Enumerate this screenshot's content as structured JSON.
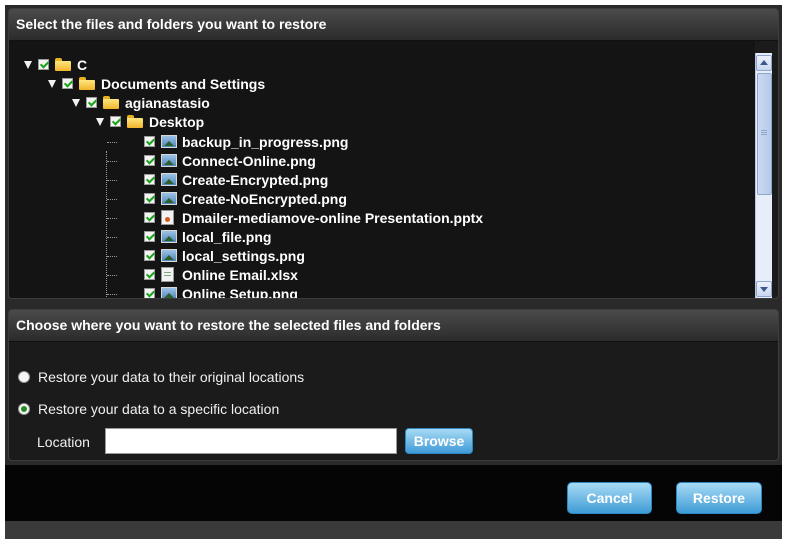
{
  "restore_panel": {
    "title": "Select the files and folders you want to restore",
    "tree": [
      {
        "label": "C",
        "icon": "folder-icon",
        "checked": true,
        "expanded": true
      },
      {
        "label": "Documents and Settings",
        "icon": "folder-icon",
        "checked": true,
        "expanded": true
      },
      {
        "label": "agianastasio",
        "icon": "folder-icon",
        "checked": true,
        "expanded": true
      },
      {
        "label": "Desktop",
        "icon": "folder-icon",
        "checked": true,
        "expanded": true
      },
      {
        "label": "backup_in_progress.png",
        "icon": "image-file-icon",
        "checked": true
      },
      {
        "label": "Connect-Online.png",
        "icon": "image-file-icon",
        "checked": true
      },
      {
        "label": "Create-Encrypted.png",
        "icon": "image-file-icon",
        "checked": true
      },
      {
        "label": "Create-NoEncrypted.png",
        "icon": "image-file-icon",
        "checked": true
      },
      {
        "label": "Dmailer-mediamove-online Presentation.pptx",
        "icon": "presentation-file-icon",
        "checked": true
      },
      {
        "label": "local_file.png",
        "icon": "image-file-icon",
        "checked": true
      },
      {
        "label": "local_settings.png",
        "icon": "image-file-icon",
        "checked": true
      },
      {
        "label": "Online Email.xlsx",
        "icon": "spreadsheet-file-icon",
        "checked": true
      },
      {
        "label": "Online Setup.png",
        "icon": "image-file-icon",
        "checked": true
      }
    ]
  },
  "location_panel": {
    "title": "Choose where you want to restore the selected files and folders",
    "option_original": "Restore your data to their original locations",
    "option_specific": "Restore your data to a specific location",
    "selected_option": "specific",
    "location_label": "Location",
    "location_value": "",
    "browse_label": "Browse"
  },
  "footer": {
    "cancel_label": "Cancel",
    "restore_label": "Restore"
  },
  "colors": {
    "button_gradient_top": "#a8dbf5",
    "button_gradient_bottom": "#3f9bd6",
    "panel_background": "#1b1b1b",
    "checkmark": "#1aa31a"
  }
}
